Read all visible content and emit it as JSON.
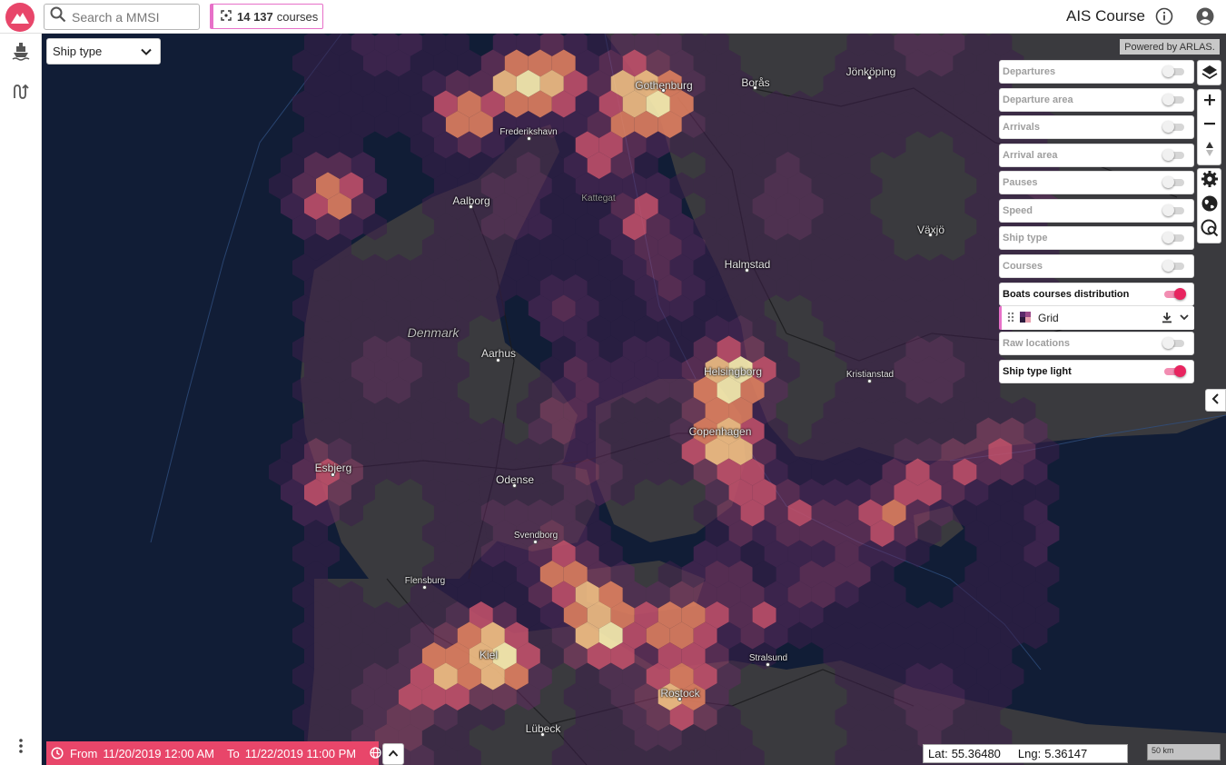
{
  "header": {
    "search_placeholder": "Search a MMSI",
    "count_value": "14 137",
    "count_unit": "courses",
    "app_title": "AIS Course"
  },
  "filter": {
    "ship_type_label": "Ship type"
  },
  "attribution": "Powered by ARLAS.",
  "layers": [
    {
      "label": "Departures",
      "enabled": false
    },
    {
      "label": "Departure area",
      "enabled": false
    },
    {
      "label": "Arrivals",
      "enabled": false
    },
    {
      "label": "Arrival area",
      "enabled": false
    },
    {
      "label": "Pauses",
      "enabled": false
    },
    {
      "label": "Speed",
      "enabled": false
    },
    {
      "label": "Ship type",
      "enabled": false
    },
    {
      "label": "Courses",
      "enabled": false
    },
    {
      "label": "Boats courses distribution",
      "enabled": true
    },
    {
      "label": "Raw locations",
      "enabled": false
    },
    {
      "label": "Ship type light",
      "enabled": true
    }
  ],
  "sublayer": {
    "label": "Grid"
  },
  "timeline": {
    "from_label": "From",
    "from_value": "11/20/2019 12:00 AM",
    "to_label": "To",
    "to_value": "11/22/2019 11:00 PM"
  },
  "coordinates": {
    "lat_label": "Lat:",
    "lat_value": "55.36480",
    "lng_label": "Lng:",
    "lng_value": "5.36147"
  },
  "scale_label": "50 km",
  "places": [
    {
      "name": "Gothenburg"
    },
    {
      "name": "Borås"
    },
    {
      "name": "Jönköping"
    },
    {
      "name": "Frederikshavn"
    },
    {
      "name": "Aalborg"
    },
    {
      "name": "Kattegat"
    },
    {
      "name": "Växjö"
    },
    {
      "name": "Halmstad"
    },
    {
      "name": "Denmark"
    },
    {
      "name": "Aarhus"
    },
    {
      "name": "Helsingborg"
    },
    {
      "name": "Kristianstad"
    },
    {
      "name": "Copenhagen"
    },
    {
      "name": "Esbjerg"
    },
    {
      "name": "Odense"
    },
    {
      "name": "Svendborg"
    },
    {
      "name": "Flensburg"
    },
    {
      "name": "Stralsund"
    },
    {
      "name": "Kiel"
    },
    {
      "name": "Rostock"
    },
    {
      "name": "Lübeck"
    }
  ],
  "colors": {
    "brand": "#e8466a",
    "sea": "#111d36",
    "land": "#3a3a3e",
    "hex_low": "#3d1f4a",
    "hex_high": "#fff2b3"
  }
}
